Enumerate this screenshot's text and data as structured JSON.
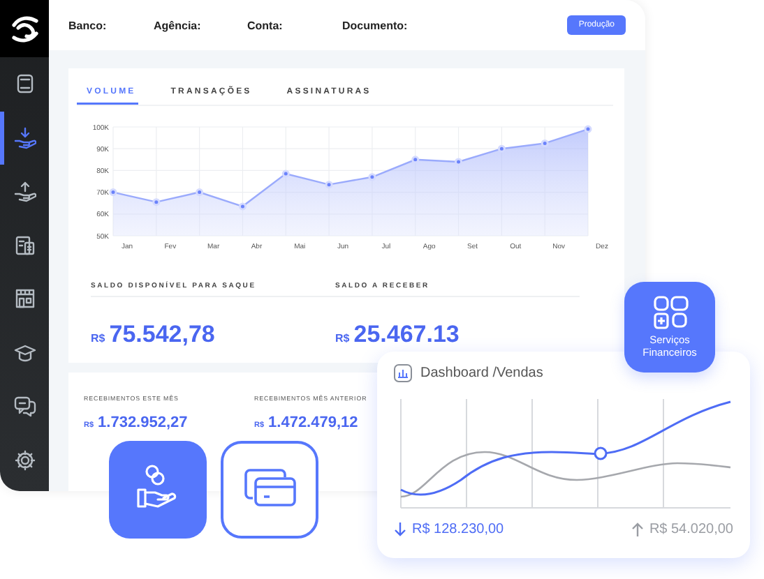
{
  "sidebar": {
    "items": [
      {
        "selected": false
      },
      {
        "selected": true
      },
      {
        "selected": false
      },
      {
        "selected": false
      },
      {
        "selected": false
      },
      {
        "selected": false
      },
      {
        "selected": false
      },
      {
        "selected": false
      }
    ]
  },
  "header": {
    "fields": [
      "Banco:",
      "Agência:",
      "Conta:",
      "Documento:"
    ],
    "button": "Produção"
  },
  "tabs": [
    {
      "label": "VOLUME",
      "selected": true
    },
    {
      "label": "TRANSAÇÕES",
      "selected": false
    },
    {
      "label": "ASSINATURAS",
      "selected": false
    }
  ],
  "chart_data": {
    "type": "area",
    "categories": [
      "Jan",
      "Fev",
      "Mar",
      "Abr",
      "Mai",
      "Jun",
      "Jul",
      "Ago",
      "Set",
      "Out",
      "Nov",
      "Dez"
    ],
    "values": [
      70000,
      65500,
      70000,
      63500,
      78500,
      73500,
      77000,
      85000,
      84000,
      90000,
      92500,
      99000
    ],
    "ylim": [
      50000,
      100000
    ],
    "grid": true,
    "yticks": [
      {
        "value": 50000,
        "label": "50K"
      },
      {
        "value": 60000,
        "label": "60K"
      },
      {
        "value": 70000,
        "label": "70K"
      },
      {
        "value": 80000,
        "label": "80K"
      },
      {
        "value": 90000,
        "label": "90K"
      },
      {
        "value": 100000,
        "label": "100K"
      }
    ]
  },
  "balances": [
    {
      "label": "SALDO DISPONÍVEL PARA SAQUE",
      "currency": "R$",
      "amount": "75.542,78"
    },
    {
      "label": "SALDO A RECEBER",
      "currency": "R$",
      "amount": "25.467.13"
    }
  ],
  "receipts": [
    {
      "label": "RECEBIMENTOS ESTE MÊS",
      "currency": "R$",
      "amount": "1.732.952,27"
    },
    {
      "label": "RECEBIMENTOS MÊS ANTERIOR",
      "currency": "R$",
      "amount": "1.472.479,12"
    }
  ],
  "services_button": {
    "label": "Serviços Financeiros"
  },
  "dashboard_card": {
    "title": "Dashboard /Vendas",
    "totals": [
      {
        "kind": "down",
        "text": "R$ 128.230,00"
      },
      {
        "kind": "up",
        "text": "R$ 54.020,00"
      }
    ]
  }
}
